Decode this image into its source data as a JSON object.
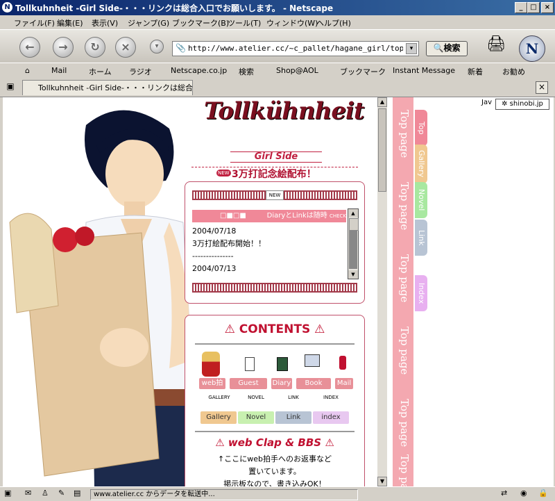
{
  "window": {
    "title": "Tollkuhnheit -Girl Side-・・・リンクは総合入口でお願いします。 - Netscape",
    "app_icon": "N"
  },
  "menu": [
    "ファイル(F)",
    "編集(E)",
    "表示(V)",
    "ジャンプ(G)",
    "ブックマーク(B)",
    "ツール(T)",
    "ウィンドウ(W)",
    "ヘルプ(H)"
  ],
  "nav": {
    "url": "http://www.atelier.cc/~c_pallet/hagane_girl/top.htm",
    "search_label": "検索",
    "logo": "N"
  },
  "personal_toolbar": [
    "Mail",
    "ホーム",
    "ラジオ",
    "Netscape.co.jp",
    "検索",
    "Shop@AOL",
    "ブックマーク",
    "Instant Message",
    "新着",
    "お勧め"
  ],
  "tab": {
    "label": "Tollkuhnheit -Girl Side-・・・リンクは総合入..."
  },
  "page": {
    "logo_title": "Tollkühnheit",
    "logo_subtitle": "Girl Side",
    "new_badge": "NEW",
    "headline": "3万打記念絵配布！",
    "news_header": "DiaryとLinkは随時",
    "news_check": "CHECK",
    "news": [
      {
        "date": "2004/07/18",
        "text": "3万打絵配布開始！！"
      },
      {
        "date": "2004/07/13",
        "text": ""
      }
    ],
    "news_sep": "---------------",
    "contents_title": "CONTENTS",
    "menu_row1": [
      {
        "label": "web拍手",
        "color": "#e89098"
      },
      {
        "label": "Guest Book",
        "color": "#e89098"
      },
      {
        "label": "Diary",
        "color": "#e89098"
      },
      {
        "label": "Book Mark",
        "color": "#e89098"
      },
      {
        "label": "Mail",
        "color": "#e89098"
      }
    ],
    "menu_row2_icons": [
      "GALLERY",
      "NOVEL",
      "LINK",
      "INDEX"
    ],
    "menu_row2": [
      {
        "label": "Gallery",
        "color": "#f0c890"
      },
      {
        "label": "Novel",
        "color": "#c8f0b0"
      },
      {
        "label": "Link",
        "color": "#b8c4d4"
      },
      {
        "label": "index",
        "color": "#e8c8f0"
      }
    ],
    "clap_title": "web Clap & BBS",
    "clap_lines": [
      "↑ここにweb拍手へのお返事など",
      "置いています。",
      "掲示板なので、書き込みOK！"
    ]
  },
  "right_frame": {
    "ad_prefix": "Jav",
    "ad_label": "shinobi.jp",
    "tabs": [
      {
        "label": "Top",
        "color": "#f08898"
      },
      {
        "label": "Gallery",
        "color": "#f0c890"
      },
      {
        "label": "Novel",
        "color": "#a8e8a0"
      },
      {
        "label": "Link",
        "color": "#b8c4d4"
      },
      {
        "label": "Index",
        "color": "#e8b0f0"
      }
    ],
    "stripe_text": "Top page"
  },
  "status": {
    "text": "www.atelier.cc からデータを転送中..."
  }
}
